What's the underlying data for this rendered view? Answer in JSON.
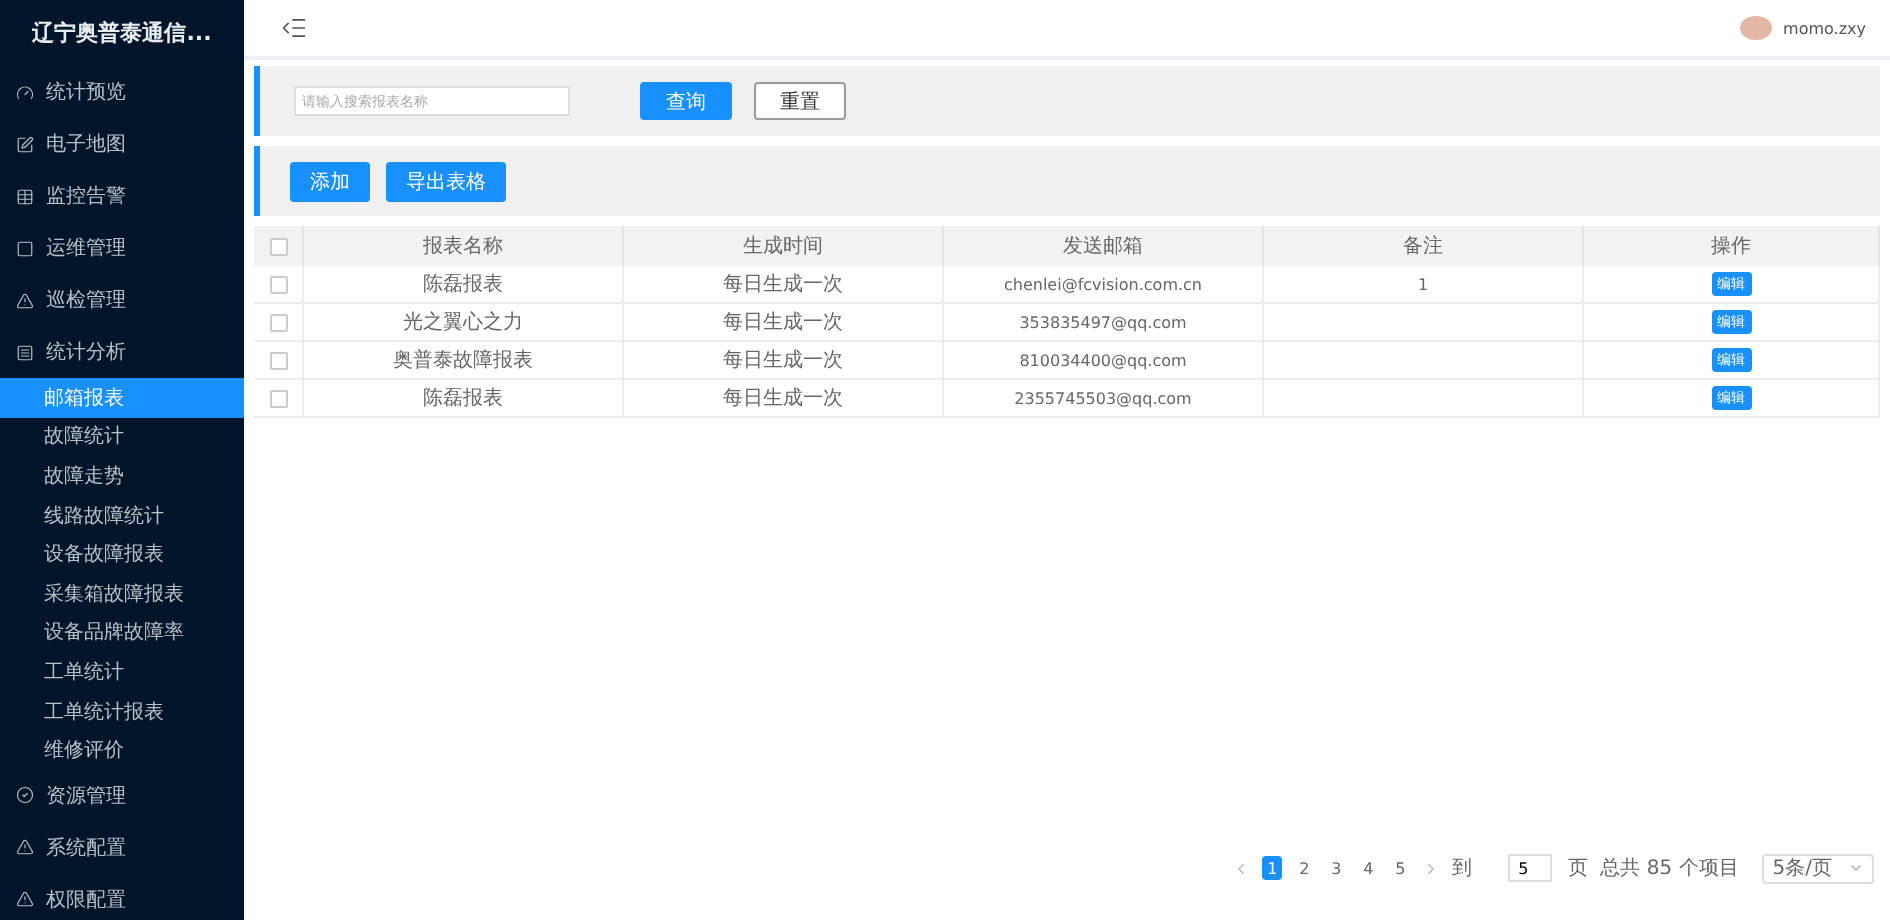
{
  "sidebar": {
    "title": "辽宁奥普泰通信...",
    "items": [
      {
        "label": "统计预览",
        "selected": false
      },
      {
        "label": "电子地图",
        "selected": false
      },
      {
        "label": "监控告警",
        "selected": false
      },
      {
        "label": "运维管理",
        "selected": false
      },
      {
        "label": "巡检管理",
        "selected": false
      },
      {
        "label": "统计分析",
        "selected": false,
        "expanded": true,
        "children": [
          {
            "label": "邮箱报表",
            "selected": true
          },
          {
            "label": "故障统计",
            "selected": false
          },
          {
            "label": "故障走势",
            "selected": false
          },
          {
            "label": "线路故障统计",
            "selected": false
          },
          {
            "label": "设备故障报表",
            "selected": false
          },
          {
            "label": "采集箱故障报表",
            "selected": false
          },
          {
            "label": "设备品牌故障率",
            "selected": false
          },
          {
            "label": "工单统计",
            "selected": false
          },
          {
            "label": "工单统计报表",
            "selected": false
          },
          {
            "label": "维修评价",
            "selected": false
          }
        ]
      },
      {
        "label": "资源管理",
        "selected": false
      },
      {
        "label": "系统配置",
        "selected": false
      },
      {
        "label": "权限配置",
        "selected": false
      }
    ]
  },
  "header": {
    "user": "momo.zxy"
  },
  "search": {
    "placeholder": "请输入搜索报表名称",
    "buttons": [
      {
        "label": "查询",
        "kind": "primary"
      },
      {
        "label": "重置",
        "kind": "outline"
      }
    ]
  },
  "actions": [
    "添加",
    "导出表格"
  ],
  "table": {
    "header_checked": false,
    "columns": [
      "报表名称",
      "生成时间",
      "发送邮箱",
      "备注",
      "操作"
    ],
    "rows": [
      {
        "checked": false,
        "cells": [
          "陈磊报表",
          "每日生成一次",
          "chenlei@fcvision.com.cn",
          "1"
        ],
        "action": "编辑"
      },
      {
        "checked": false,
        "cells": [
          "光之翼心之力",
          "每日生成一次",
          "353835497@qq.com",
          ""
        ],
        "action": "编辑"
      },
      {
        "checked": false,
        "cells": [
          "奥普泰故障报表",
          "每日生成一次",
          "810034400@qq.com",
          ""
        ],
        "action": "编辑"
      },
      {
        "checked": false,
        "cells": [
          "陈磊报表",
          "每日生成一次",
          "2355745503@qq.com",
          ""
        ],
        "action": "编辑"
      }
    ]
  },
  "pagination": {
    "pages": [
      {
        "label": "1",
        "selected": true
      },
      {
        "label": "2",
        "selected": false
      },
      {
        "label": "3",
        "selected": false
      },
      {
        "label": "4",
        "selected": false
      },
      {
        "label": "5",
        "selected": false
      }
    ],
    "goto_label": "到",
    "goto_value": "5",
    "page_label": "页",
    "total": "总共 85 个项目",
    "page_size": "5条/页"
  }
}
